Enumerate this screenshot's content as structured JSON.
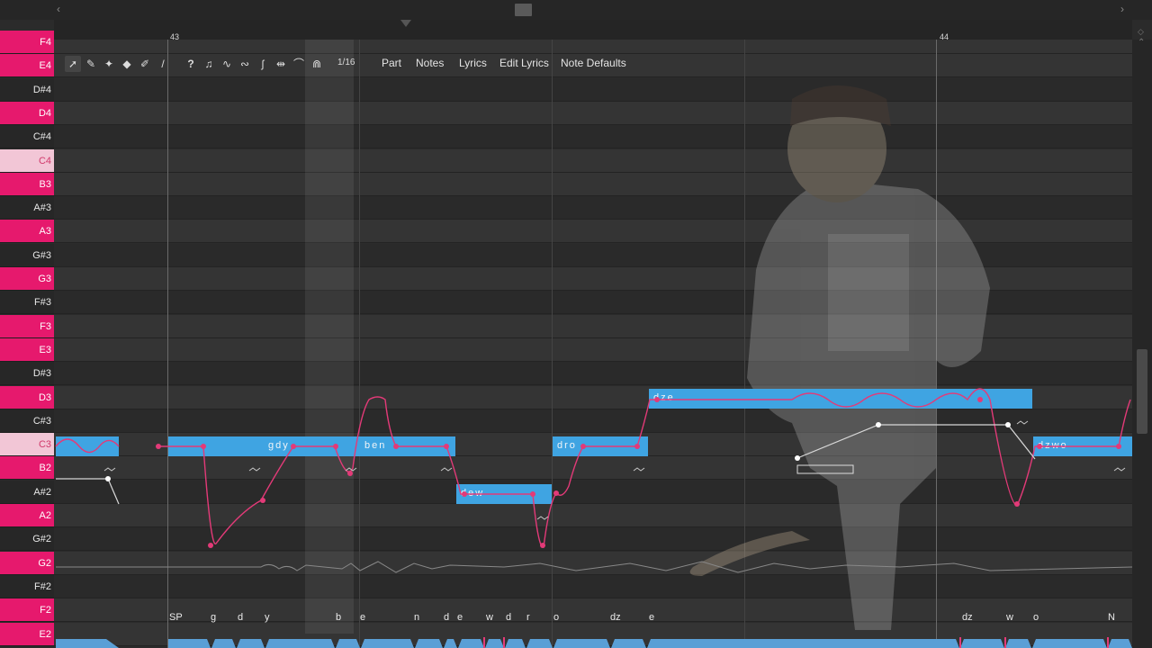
{
  "ruler": {
    "bar_start": "43",
    "bar_next": "44"
  },
  "keys": [
    {
      "label": "F4",
      "type": "white"
    },
    {
      "label": "E4",
      "type": "white"
    },
    {
      "label": "D#4",
      "type": "black"
    },
    {
      "label": "D4",
      "type": "white"
    },
    {
      "label": "C#4",
      "type": "black"
    },
    {
      "label": "C4",
      "type": "cmark"
    },
    {
      "label": "B3",
      "type": "white"
    },
    {
      "label": "A#3",
      "type": "black"
    },
    {
      "label": "A3",
      "type": "white"
    },
    {
      "label": "G#3",
      "type": "black"
    },
    {
      "label": "G3",
      "type": "white"
    },
    {
      "label": "F#3",
      "type": "black"
    },
    {
      "label": "F3",
      "type": "white"
    },
    {
      "label": "E3",
      "type": "white"
    },
    {
      "label": "D#3",
      "type": "black"
    },
    {
      "label": "D3",
      "type": "white"
    },
    {
      "label": "C#3",
      "type": "black"
    },
    {
      "label": "C3",
      "type": "cmark"
    },
    {
      "label": "B2",
      "type": "white"
    },
    {
      "label": "A#2",
      "type": "black"
    },
    {
      "label": "A2",
      "type": "white"
    },
    {
      "label": "G#2",
      "type": "black"
    },
    {
      "label": "G2",
      "type": "white"
    },
    {
      "label": "F#2",
      "type": "black"
    },
    {
      "label": "F2",
      "type": "white"
    },
    {
      "label": "E2",
      "type": "white"
    }
  ],
  "toolbar": {
    "snap": "1/16",
    "tabs": {
      "part": "Part",
      "notes": "Notes",
      "lyrics": "Lyrics",
      "edit_lyrics": "Edit Lyrics",
      "note_defaults": "Note Defaults"
    }
  },
  "notes": [
    {
      "lyric": "",
      "pitch": "C3"
    },
    {
      "lyric": "",
      "pitch": "C3"
    },
    {
      "lyric": "gdy",
      "pitch": "C3"
    },
    {
      "lyric": "ben",
      "pitch": "C3"
    },
    {
      "lyric": "dew",
      "pitch": "A#2"
    },
    {
      "lyric": "dro",
      "pitch": "C3"
    },
    {
      "lyric": "dze",
      "pitch": "D3"
    },
    {
      "lyric": "dzwo",
      "pitch": "C3"
    }
  ],
  "phonemes": [
    "SP",
    "g",
    "d",
    "y",
    "b",
    "e",
    "n",
    "d",
    "e",
    "w",
    "d",
    "r",
    "o",
    "dz",
    "e",
    "dz",
    "w",
    "o",
    "N"
  ],
  "colors": {
    "note": "#3fa4e2",
    "pitch_curve": "#e33a78",
    "white_key": "#e6196d",
    "c_key": "#f2c6d6"
  }
}
